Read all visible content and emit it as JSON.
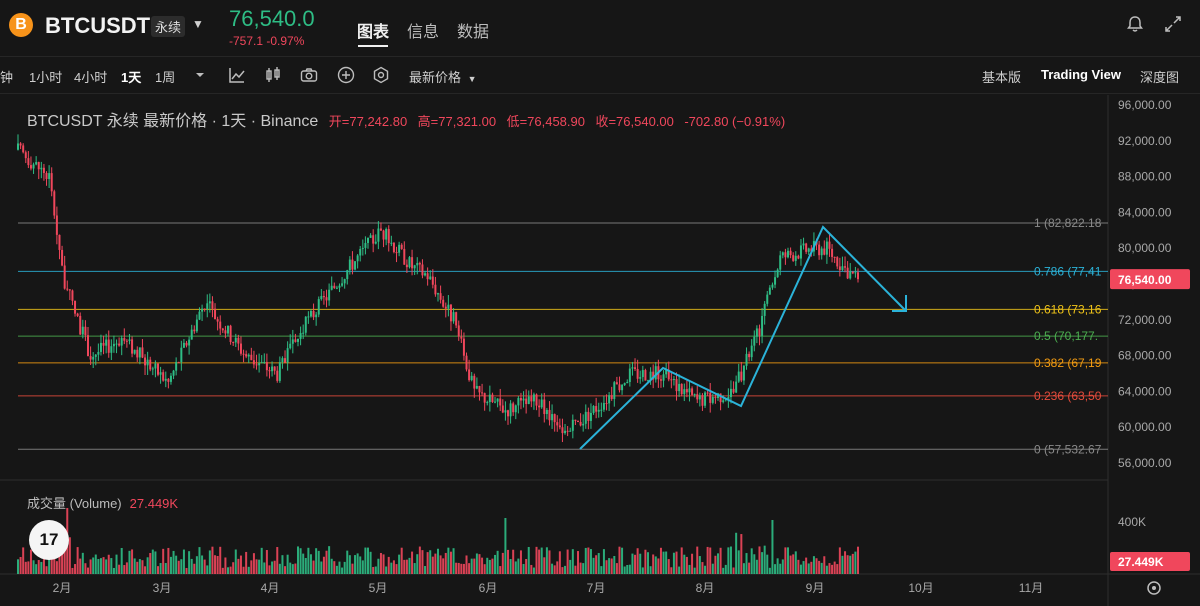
{
  "header": {
    "coin_icon": "B",
    "symbol": "BTCUSDT",
    "contract_badge": "永续",
    "last_price": "76,540.0",
    "price_change": "-757.1  -0.97%",
    "tabs": [
      {
        "label": "图表",
        "active": true
      },
      {
        "label": "信息",
        "active": false
      },
      {
        "label": "数据",
        "active": false
      }
    ],
    "icons": [
      "bell-icon",
      "fullscreen-icon"
    ]
  },
  "toolbar": {
    "timeframes": [
      {
        "label": "钟"
      },
      {
        "label": "1小时"
      },
      {
        "label": "4小时"
      },
      {
        "label": "1天",
        "active": true
      },
      {
        "label": "1周"
      }
    ],
    "tools": [
      "chevron-down-icon",
      "indicator-icon",
      "candle-type-icon",
      "camera-icon",
      "plus-circle-icon",
      "settings-hex-icon"
    ],
    "price_type": "最新价格",
    "views": [
      {
        "label": "基本版"
      },
      {
        "label": "Trading View",
        "active": true
      },
      {
        "label": "深度图"
      }
    ]
  },
  "legend": {
    "title": "BTCUSDT 永续 最新价格 · 1天 · Binance",
    "open": "开=77,242.80",
    "high": "高=77,321.00",
    "low": "低=76,458.90",
    "close": "收=76,540.00",
    "change": "-702.80 (−0.91%)"
  },
  "volume_legend": {
    "label": "成交量 (Volume)",
    "value": "27.449K"
  },
  "tv_logo": "17",
  "colors": {
    "up": "#2ebd85",
    "down": "#f0475c",
    "drawing": "#2bb3d9",
    "background": "#161616"
  },
  "chart_data": {
    "type": "candlestick",
    "price_axis": [
      "96,000.00",
      "92,000.00",
      "88,000.00",
      "84,000.00",
      "80,000.00",
      "76,000.00",
      "72,000.00",
      "68,000.00",
      "64,000.00",
      "60,000.00",
      "56,000.00"
    ],
    "price_ticks": [
      96000,
      92000,
      88000,
      84000,
      80000,
      76000,
      72000,
      68000,
      64000,
      60000,
      56000
    ],
    "ylim": [
      55000,
      97000
    ],
    "last_price_label": "76,540.00",
    "last_price": 76540,
    "months": [
      "2月",
      "3月",
      "4月",
      "5月",
      "6月",
      "7月",
      "8月",
      "9月",
      "10月",
      "11月"
    ],
    "fibonacci": [
      {
        "label": "1 (82,822.18",
        "value": 82822,
        "color": "#8a8a8a"
      },
      {
        "label": "0.786 (77,41",
        "value": 77410,
        "color": "#2bb3d9"
      },
      {
        "label": "0.618 (73,16",
        "value": 73160,
        "color": "#f0c419"
      },
      {
        "label": "0.5 (70,177.",
        "value": 70177,
        "color": "#4caf50"
      },
      {
        "label": "0.382 (67,19",
        "value": 67190,
        "color": "#f39c12"
      },
      {
        "label": "0.236 (63,50",
        "value": 63500,
        "color": "#e74c3c"
      },
      {
        "label": "0 (57,532.67",
        "value": 57533,
        "color": "#8a8a8a"
      }
    ],
    "volume_axis": [
      "400K"
    ],
    "volume_last": "27.449K"
  }
}
